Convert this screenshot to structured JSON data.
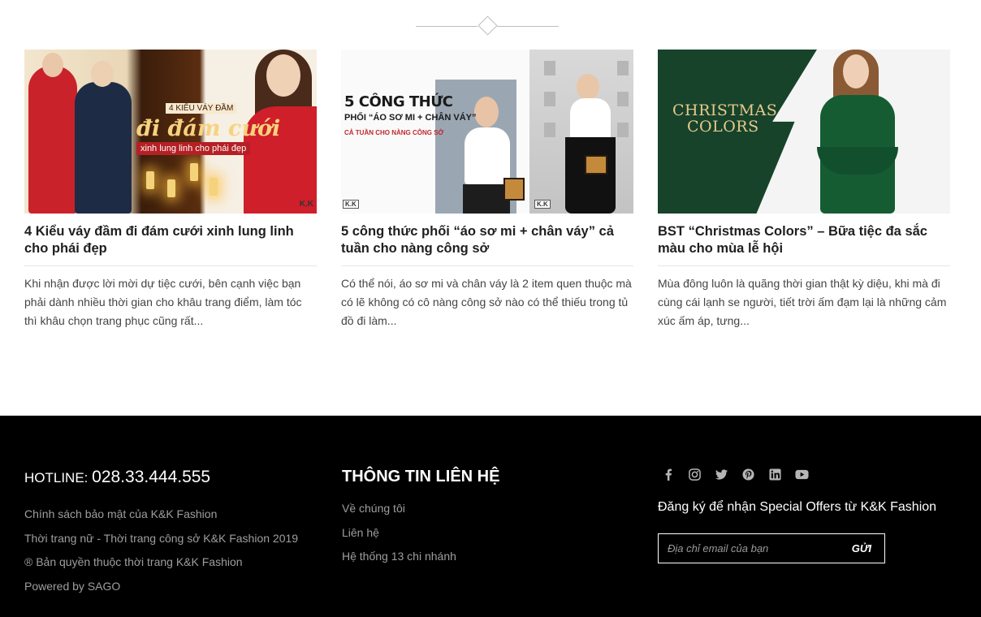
{
  "articles": [
    {
      "title": "4 Kiểu váy đầm đi đám cưới xinh lung linh cho phái đẹp",
      "excerpt": "Khi nhận được lời mời dự tiệc cưới, bên cạnh việc bạn phải dành nhiều thời gian cho khâu trang điểm, làm tóc thì khâu chọn trang phục cũng rất...",
      "image_text": {
        "line1": "4 KIỂU VÁY ĐẦM",
        "line2": "đi đám cưới",
        "line3": "xinh lung linh cho phái đẹp",
        "logo": "K.K"
      }
    },
    {
      "title": "5 công thức phối “áo sơ mi + chân váy” cả tuần cho nàng công sở",
      "excerpt": "Có thể nói, áo sơ mi và chân váy là 2 item quen thuộc mà có lẽ không có cô nàng công sở nào có thể thiếu trong tủ đồ đi làm...",
      "image_text": {
        "line1": "5 CÔNG THỨC",
        "line2": "PHỐI “ÁO SƠ MI + CHÂN VÁY”",
        "line3": "CẢ TUẦN CHO NÀNG CÔNG SỞ",
        "logo": "K.K"
      }
    },
    {
      "title": "BST “Christmas Colors” – Bữa tiệc đa sắc màu cho mùa lễ hội",
      "excerpt": "Mùa đông luôn là quãng thời gian thật kỳ diệu, khi mà đi cùng cái lạnh se người, tiết trời ấm đạm lại là những cảm xúc ấm áp, tưng...",
      "image_text": {
        "line1": "CHRISTMAS",
        "line2": "COLORS"
      }
    }
  ],
  "footer": {
    "hotline_label": "HOTLINE:",
    "hotline_number": "028.33.444.555",
    "col1_links": [
      "Chính sách bảo mật của K&K Fashion",
      "Thời trang nữ - Thời trang công sở K&K Fashion 2019",
      "® Bản quyền thuộc thời trang K&K Fashion",
      "Powered by SAGO"
    ],
    "contact_heading": "THÔNG TIN LIÊN HỆ",
    "contact_links": [
      "Về chúng tôi",
      "Liên hệ",
      "Hệ thống 13 chi nhánh"
    ],
    "socials": [
      {
        "icon": "facebook-icon",
        "glyph": "f"
      },
      {
        "icon": "instagram-icon",
        "glyph": "◎"
      },
      {
        "icon": "twitter-icon",
        "glyph": "🐦"
      },
      {
        "icon": "pinterest-icon",
        "glyph": "℗"
      },
      {
        "icon": "linkedin-icon",
        "glyph": "in"
      },
      {
        "icon": "youtube-icon",
        "glyph": "▶"
      }
    ],
    "subscribe_text": "Đăng ký để nhận Special Offers từ K&K Fashion",
    "email_placeholder": "Địa chỉ email của bạn",
    "submit_label": "GỬI"
  },
  "colors": {
    "footer_bg": "#000000",
    "christmas_green": "#17432b",
    "accent_red": "#c9222b"
  }
}
